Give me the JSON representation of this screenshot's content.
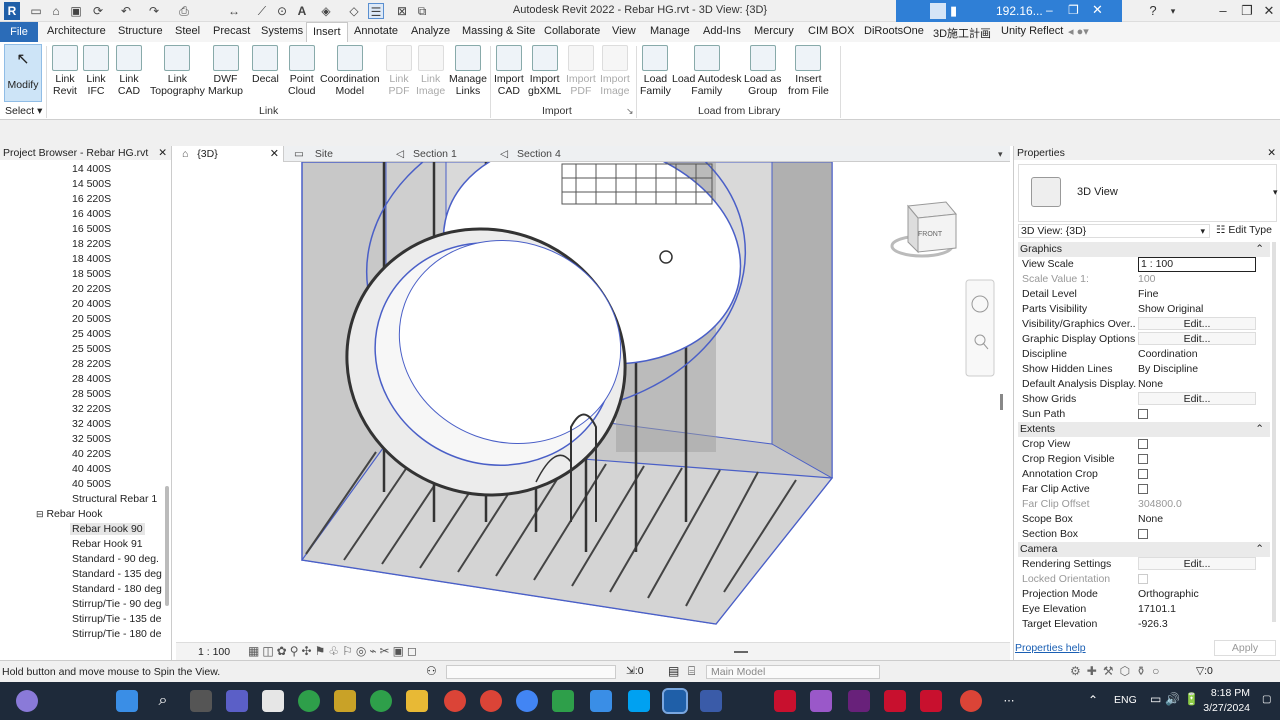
{
  "titlebar": {
    "title": "Autodesk Revit 2022 - Rebar HG.rvt - 3D View: {3D}",
    "connection_ip": "192.16..."
  },
  "ribbon_tabs": [
    "File",
    "Architecture",
    "Structure",
    "Steel",
    "Precast",
    "Systems",
    "Insert",
    "Annotate",
    "Analyze",
    "Massing & Site",
    "Collaborate",
    "View",
    "Manage",
    "Add-Ins",
    "Mercury",
    "CIM BOX",
    "DiRootsOne",
    "3D施工計画",
    "Unity Reflect"
  ],
  "ribbon": {
    "modify_label": "Modify",
    "select_label": "Select",
    "link_buttons": [
      {
        "label": "Link\nRevit",
        "enabled": true
      },
      {
        "label": "Link\nIFC",
        "enabled": true
      },
      {
        "label": "Link\nCAD",
        "enabled": true
      },
      {
        "label": "Link\nTopography",
        "enabled": true
      },
      {
        "label": "DWF\nMarkup",
        "enabled": true
      },
      {
        "label": "Decal",
        "enabled": true
      },
      {
        "label": "Point\nCloud",
        "enabled": true
      },
      {
        "label": "Coordination\nModel",
        "enabled": true
      },
      {
        "label": "Link\nPDF",
        "enabled": false
      },
      {
        "label": "Link\nImage",
        "enabled": false
      },
      {
        "label": "Manage\nLinks",
        "enabled": true
      }
    ],
    "import_buttons": [
      {
        "label": "Import\nCAD",
        "enabled": true
      },
      {
        "label": "Import\ngbXML",
        "enabled": true
      },
      {
        "label": "Import\nPDF",
        "enabled": false
      },
      {
        "label": "Import\nImage",
        "enabled": false
      }
    ],
    "library_buttons": [
      {
        "label": "Load\nFamily",
        "enabled": true
      },
      {
        "label": "Load Autodesk\nFamily",
        "enabled": true
      },
      {
        "label": "Load as\nGroup",
        "enabled": true
      },
      {
        "label": "Insert\nfrom File",
        "enabled": true
      }
    ],
    "panels": {
      "link": "Link",
      "import": "Import",
      "library": "Load from Library"
    }
  },
  "project_browser": {
    "title": "Project Browser - Rebar HG.rvt",
    "items": [
      "14 400S",
      "14 500S",
      "16 220S",
      "16 400S",
      "16 500S",
      "18 220S",
      "18 400S",
      "18 500S",
      "20 220S",
      "20 400S",
      "20 500S",
      "25 400S",
      "25 500S",
      "28 220S",
      "28 400S",
      "28 500S",
      "32 220S",
      "32 400S",
      "32 500S",
      "40 220S",
      "40 400S",
      "40 500S",
      "Structural Rebar 1"
    ],
    "group_label": "Rebar Hook",
    "group_items": [
      "Rebar Hook 90",
      "Rebar Hook 91",
      "Standard - 90 deg.",
      "Standard - 135 deg",
      "Standard - 180 deg",
      "Stirrup/Tie - 90 deg",
      "Stirrup/Tie - 135 de",
      "Stirrup/Tie - 180 de"
    ]
  },
  "view_tabs": [
    {
      "label": "{3D}",
      "active": true
    },
    {
      "label": "Site",
      "active": false
    },
    {
      "label": "Section 1",
      "active": false
    },
    {
      "label": "Section 4",
      "active": false
    }
  ],
  "view_scale_bar": "1 : 100",
  "viewcube_label": "FRONT",
  "properties": {
    "title": "Properties",
    "type_name": "3D View",
    "selector": "3D View: {3D}",
    "edit_type": "Edit Type",
    "sections": [
      {
        "name": "Graphics",
        "rows": [
          {
            "k": "View Scale",
            "v": "1 : 100",
            "kind": "input"
          },
          {
            "k": "Scale Value    1:",
            "v": "100",
            "kind": "disabled"
          },
          {
            "k": "Detail Level",
            "v": "Fine"
          },
          {
            "k": "Parts Visibility",
            "v": "Show Original"
          },
          {
            "k": "Visibility/Graphics Over...",
            "v": "Edit...",
            "kind": "button"
          },
          {
            "k": "Graphic Display Options",
            "v": "Edit...",
            "kind": "button"
          },
          {
            "k": "Discipline",
            "v": "Coordination"
          },
          {
            "k": "Show Hidden Lines",
            "v": "By Discipline"
          },
          {
            "k": "Default Analysis Display...",
            "v": "None"
          },
          {
            "k": "Show Grids",
            "v": "Edit...",
            "kind": "button"
          },
          {
            "k": "Sun Path",
            "v": "",
            "kind": "check"
          }
        ]
      },
      {
        "name": "Extents",
        "rows": [
          {
            "k": "Crop View",
            "v": "",
            "kind": "check"
          },
          {
            "k": "Crop Region Visible",
            "v": "",
            "kind": "check"
          },
          {
            "k": "Annotation Crop",
            "v": "",
            "kind": "check"
          },
          {
            "k": "Far Clip Active",
            "v": "",
            "kind": "check"
          },
          {
            "k": "Far Clip Offset",
            "v": "304800.0",
            "kind": "disabled"
          },
          {
            "k": "Scope Box",
            "v": "None"
          },
          {
            "k": "Section Box",
            "v": "",
            "kind": "check"
          }
        ]
      },
      {
        "name": "Camera",
        "rows": [
          {
            "k": "Rendering Settings",
            "v": "Edit...",
            "kind": "button"
          },
          {
            "k": "Locked Orientation",
            "v": "",
            "kind": "disabledcheck"
          },
          {
            "k": "Projection Mode",
            "v": "Orthographic"
          },
          {
            "k": "Eye Elevation",
            "v": "17101.1"
          },
          {
            "k": "Target Elevation",
            "v": "-926.3"
          }
        ]
      }
    ],
    "help_link": "Properties help",
    "apply_label": "Apply"
  },
  "statusbar": {
    "message": "Hold button and move mouse to Spin the View.",
    "count_left": ":0",
    "model": "Main Model",
    "count_right": ":0"
  },
  "taskbar": {
    "lang": "ENG",
    "time": "8:18 PM",
    "date": "3/27/2024"
  }
}
